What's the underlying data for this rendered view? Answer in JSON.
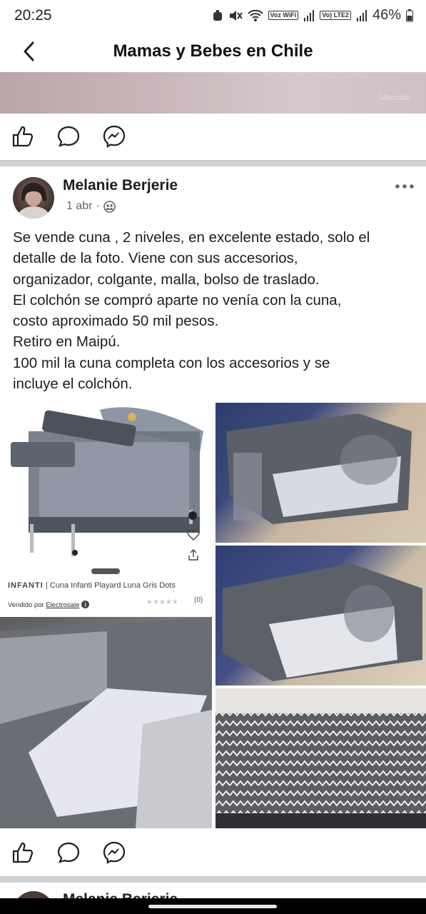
{
  "status_bar": {
    "time": "20:25",
    "battery": "46%",
    "network_1": "Voz WiFi",
    "network_2": "Vo) LTE2"
  },
  "header": {
    "title": "Mamas y Bebes en Chile"
  },
  "previous_post": {
    "image_watermark": "Mercado"
  },
  "post": {
    "author": "Melanie Berjerie",
    "date": "1 abr",
    "date_separator": "·",
    "text_lines": [
      "Se vende cuna , 2 niveles, en excelente estado, solo el",
      "detalle de la foto. Viene con sus accesorios,",
      "organizador, colgante, malla, bolso de traslado.",
      "El colchón se compró aparte no venía con la cuna,",
      "costo aproximado 50 mil pesos.",
      "Retiro en Maipú.",
      "100 mil la cuna completa con los accesorios y se",
      "incluye el colchón."
    ],
    "product_photo": {
      "brand": "INFANTI",
      "divider": "|",
      "product_name": "Cuna Infanti Playard Luna Gris Dots",
      "seller_prefix": "Vendido por",
      "seller": "Electrosale",
      "review_count": "(0)",
      "rating_stars": 0
    }
  },
  "next_post": {
    "author": "Melanie Berjerie"
  },
  "icons": {
    "back": "back-arrow-icon",
    "like": "like-icon",
    "comment": "comment-icon",
    "messenger": "messenger-icon",
    "more": "more-options-icon",
    "privacy": "group-privacy-icon"
  },
  "colors": {
    "separator": "#d0d2d6",
    "secondary_text": "#65676b",
    "icon": "#1c1e21"
  }
}
